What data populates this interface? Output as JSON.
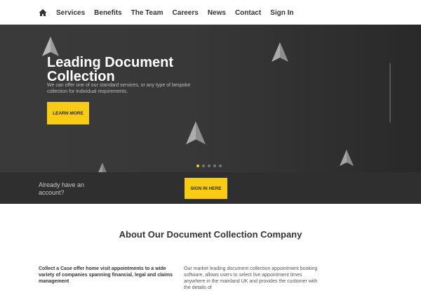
{
  "nav": {
    "home_icon": "home-icon",
    "items": [
      "Services",
      "Benefits",
      "The Team",
      "Careers",
      "News",
      "Contact",
      "Sign In"
    ]
  },
  "hero": {
    "title": "Leading Document Collection",
    "subtitle": "We can offer one of our standard services, or any type of bespoke collection for individual requirements.",
    "cta": "LEARN MORE",
    "slide_count": 5,
    "active_slide": 1
  },
  "signin": {
    "prompt": "Already have an account?",
    "button": "SIGN IN HERE"
  },
  "about": {
    "title": "About Our Document Collection Company",
    "left_text": "Collect a Case offer home visit appointments to a wide variety of companies spanning financial, legal and claims management",
    "right_text": "Our market leading document collection appointment booking software, allows users to select live appointment times anywhere in the mainland UK and provides the customer with the details of"
  },
  "colors": {
    "accent": "#f8cc12",
    "hero_bg": "#333333",
    "band_bg": "#2f2f2f"
  }
}
